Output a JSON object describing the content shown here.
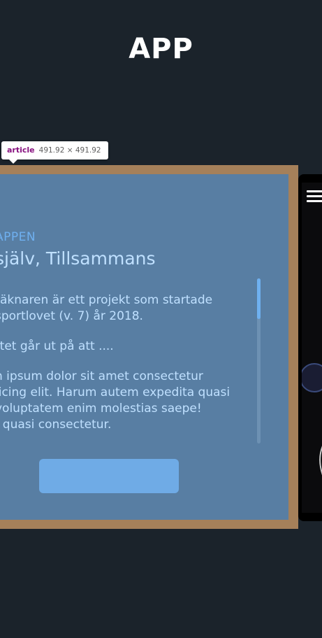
{
  "header": {
    "title": "APP"
  },
  "devtools_tooltip": {
    "tag": "article",
    "dimensions": "491.92 × 491.92"
  },
  "article": {
    "overline": "APPEN",
    "heading": "själv, Tillsammans",
    "paragraphs": [
      [
        "räknaren är ett projekt som startade",
        "sportlovet (v. 7) år 2018."
      ],
      [
        "ttet går ut på att ...."
      ],
      [
        "n ipsum dolor sit amet consectetur",
        "licing elit. Harum autem expedita quasi",
        "voluptatem enim molestias saepe!",
        ", quasi consectetur."
      ]
    ],
    "button_label": ""
  },
  "colors": {
    "background": "#1b232b",
    "card_frame": "#a5805a",
    "card_bg": "#587ea3",
    "accent": "#6fb0f0",
    "text": "#bfe0ff"
  },
  "icons": {
    "phone_menu": "hamburger-icon"
  }
}
